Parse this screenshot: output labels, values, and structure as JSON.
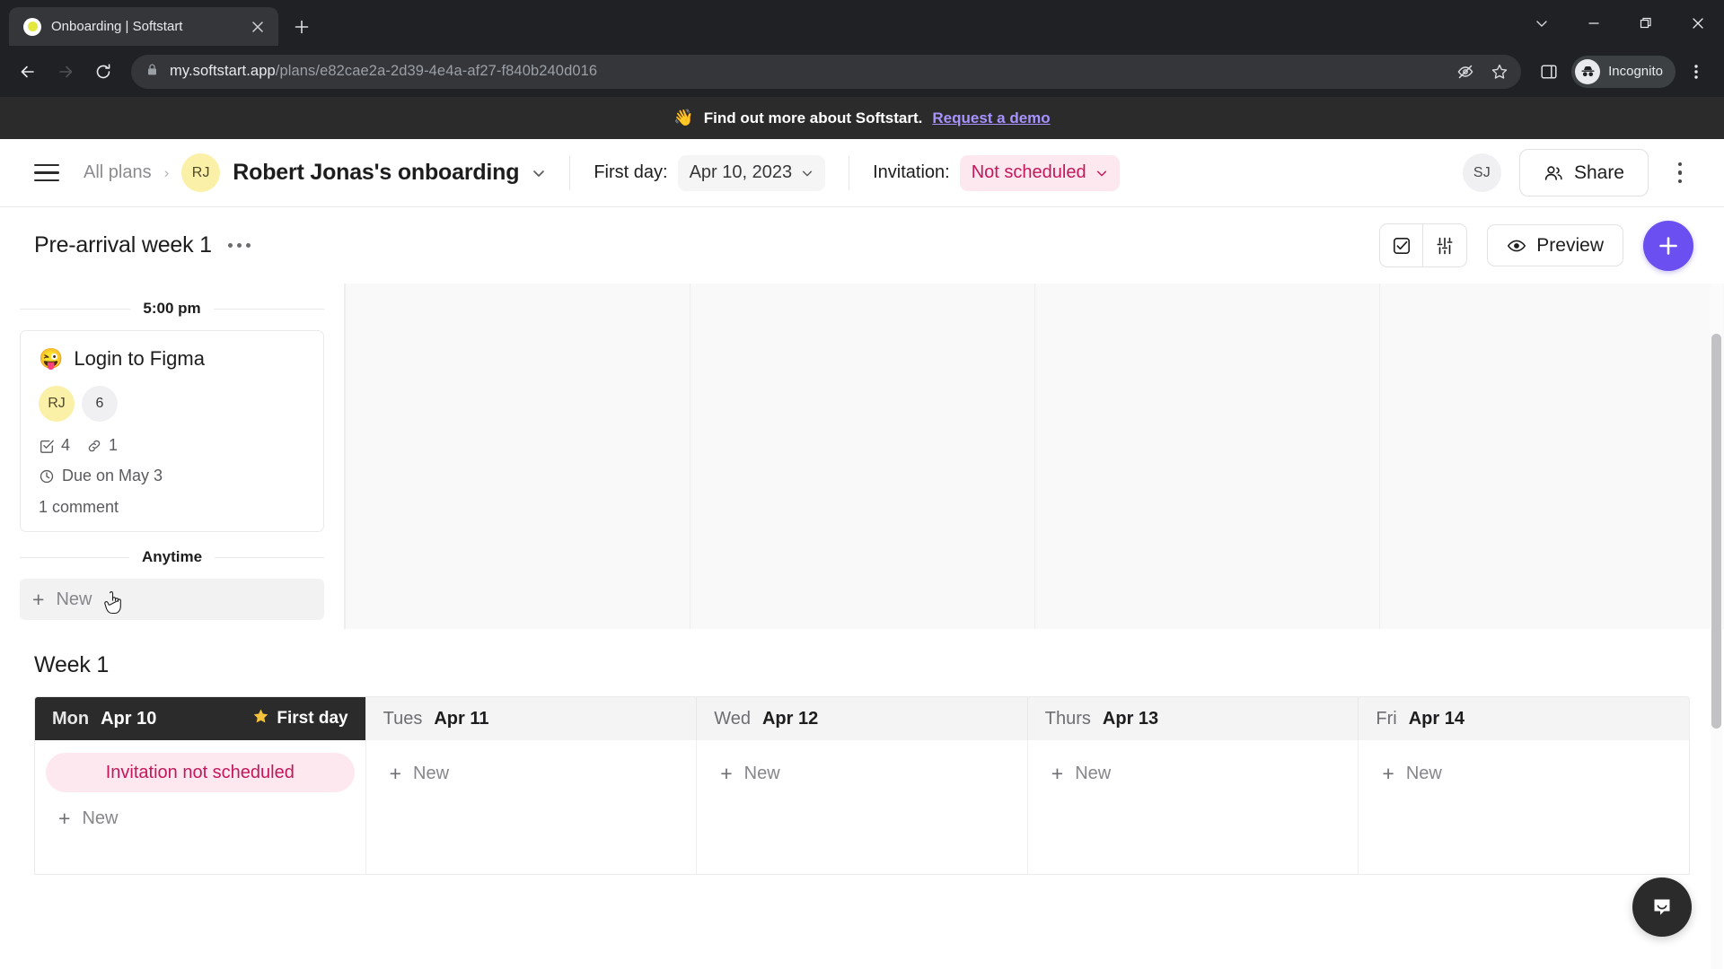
{
  "browser": {
    "tab": {
      "title": "Onboarding | Softstart",
      "favicon": "softstart-favicon",
      "close_icon": "close-icon"
    },
    "new_tab_label": "+",
    "window_controls": {
      "tab_search": "chevron-down-icon",
      "minimize": "minimize-icon",
      "maximize": "maximize-icon",
      "close": "close-icon"
    },
    "nav": {
      "back": "back-arrow-icon",
      "forward": "forward-arrow-icon",
      "reload": "reload-icon"
    },
    "omnibox": {
      "lock_icon": "lock-icon",
      "url_host": "my.softstart.app",
      "url_path": "/plans/e82cae2a-2d39-4e4a-af27-f840b240d016",
      "tracking_icon": "eye-off-icon",
      "bookmark_icon": "star-icon"
    },
    "side_panel_icon": "side-panel-icon",
    "incognito": {
      "icon": "incognito-icon",
      "label": "Incognito"
    },
    "menu_icon": "kebab-menu-icon"
  },
  "promo": {
    "emoji": "👋",
    "text": "Find out more about Softstart.",
    "link": "Request a demo"
  },
  "header": {
    "menu_icon": "hamburger-menu-icon",
    "breadcrumb": "All plans",
    "breadcrumb_sep": "›",
    "plan_avatar": "RJ",
    "plan_title": "Robert Jonas's onboarding",
    "plan_chevron": "chevron-down-icon",
    "first_day_label": "First day:",
    "first_day_value": "Apr 10, 2023",
    "invitation_label": "Invitation:",
    "invitation_value": "Not scheduled",
    "user_avatar": "SJ",
    "share_label": "Share",
    "share_icon": "people-icon",
    "more_icon": "kebab-menu-icon"
  },
  "toolbar": {
    "section_title": "Pre-arrival week 1",
    "section_menu_icon": "ellipsis-icon",
    "checklist_icon": "checkbox-icon",
    "filter_icon": "sliders-icon",
    "preview_label": "Preview",
    "preview_icon": "eye-icon",
    "add_label": "+",
    "add_icon": "plus-icon"
  },
  "prearrival": {
    "time_divider": "5:00 pm",
    "card": {
      "emoji": "😜",
      "title": "Login to Figma",
      "assignee_avatar": "RJ",
      "assignee_count": "6",
      "checklist_icon": "checkbox-icon",
      "checklist_count": "4",
      "link_icon": "link-icon",
      "link_count": "1",
      "due_icon": "clock-icon",
      "due_text": "Due on May 3",
      "comments": "1 comment"
    },
    "anytime_divider": "Anytime",
    "new_label": "New"
  },
  "week": {
    "label": "Week 1",
    "days": [
      {
        "dow": "Mon",
        "date": "Apr 10",
        "first_day": true,
        "badge": "First day",
        "badge_icon": "star-icon",
        "new_label": "New",
        "invitation_pill": "Invitation not scheduled"
      },
      {
        "dow": "Tues",
        "date": "Apr 11",
        "first_day": false,
        "new_label": "New"
      },
      {
        "dow": "Wed",
        "date": "Apr 12",
        "first_day": false,
        "new_label": "New"
      },
      {
        "dow": "Thurs",
        "date": "Apr 13",
        "first_day": false,
        "new_label": "New"
      },
      {
        "dow": "Fri",
        "date": "Apr 14",
        "first_day": false,
        "new_label": "New"
      }
    ]
  },
  "chat_widget": {
    "icon": "chat-bubble-icon"
  },
  "colors": {
    "accent_purple": "#6b4ff0",
    "link_purple": "#a892ff",
    "pink_bg": "#fde8ef",
    "pink_text": "#c2185b",
    "avatar_yellow": "#fbf0a7",
    "dark": "#2b2b2b"
  }
}
